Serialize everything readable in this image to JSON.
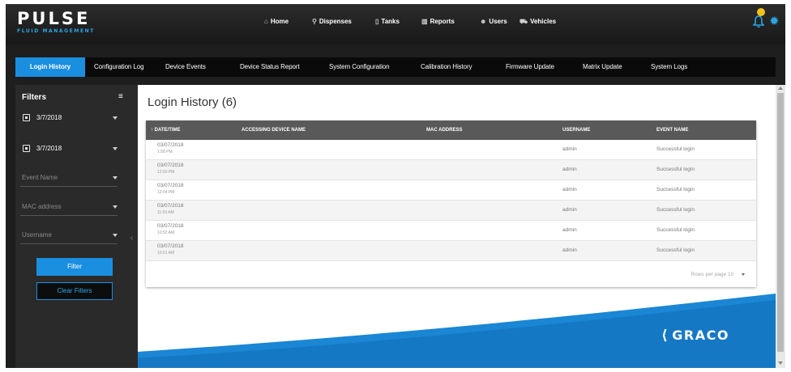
{
  "brand": {
    "name": "PULSE",
    "tagline": "FLUID MANAGEMENT",
    "footer_logo": "GRACO"
  },
  "nav": [
    {
      "icon": "home-icon",
      "glyph": "⌂",
      "label": "Home"
    },
    {
      "icon": "dispenses-icon",
      "glyph": "⚲",
      "label": "Dispenses"
    },
    {
      "icon": "tanks-icon",
      "glyph": "▯",
      "label": "Tanks"
    },
    {
      "icon": "reports-icon",
      "glyph": "▥",
      "label": "Reports"
    },
    {
      "icon": "users-icon",
      "glyph": "☻",
      "label": "Users"
    },
    {
      "icon": "vehicles-icon",
      "glyph": "⛟",
      "label": "Vehicles"
    }
  ],
  "tabs": [
    {
      "label": "Login History",
      "active": true
    },
    {
      "label": "Configuration Log",
      "active": false
    },
    {
      "label": "Device Events",
      "active": false
    },
    {
      "label": "Device Status Report",
      "active": false
    },
    {
      "label": "System Configuration",
      "active": false
    },
    {
      "label": "Calibration History",
      "active": false
    },
    {
      "label": "Firmware Update",
      "active": false
    },
    {
      "label": "Matrix Update",
      "active": false
    },
    {
      "label": "System Logs",
      "active": false
    }
  ],
  "sidebar": {
    "title": "Filters",
    "start_date": "3/7/2018",
    "end_date": "3/7/2018",
    "event_name_placeholder": "Event Name",
    "mac_placeholder": "MAC address",
    "username_placeholder": "Username",
    "filter_button": "Filter",
    "clear_button": "Clear Filters"
  },
  "main": {
    "title": "Login History (6)",
    "columns": [
      "DATE/TIME",
      "ACCESSING DEVICE NAME",
      "MAC ADDRESS",
      "USERNAME",
      "EVENT NAME"
    ],
    "rows": [
      {
        "date": "03/07/2018",
        "time": "1:58 PM",
        "device": "",
        "mac": "",
        "username": "admin",
        "event": "Successful login"
      },
      {
        "date": "03/07/2018",
        "time": "12:50 PM",
        "device": "",
        "mac": "",
        "username": "admin",
        "event": "Successful login"
      },
      {
        "date": "03/07/2018",
        "time": "12:04 PM",
        "device": "",
        "mac": "",
        "username": "admin",
        "event": "Successful login"
      },
      {
        "date": "03/07/2018",
        "time": "11:03 AM",
        "device": "",
        "mac": "",
        "username": "admin",
        "event": "Successful login"
      },
      {
        "date": "03/07/2018",
        "time": "10:52 AM",
        "device": "",
        "mac": "",
        "username": "admin",
        "event": "Successful login"
      },
      {
        "date": "03/07/2018",
        "time": "10:51 AM",
        "device": "",
        "mac": "",
        "username": "admin",
        "event": "Successful login"
      }
    ],
    "pager_label": "Rows per page",
    "pager_value": "10"
  },
  "colors": {
    "accent": "#1a8fe0",
    "notification": "#f3c218",
    "header_row": "#595959",
    "sidebar": "#2a2a2a"
  }
}
